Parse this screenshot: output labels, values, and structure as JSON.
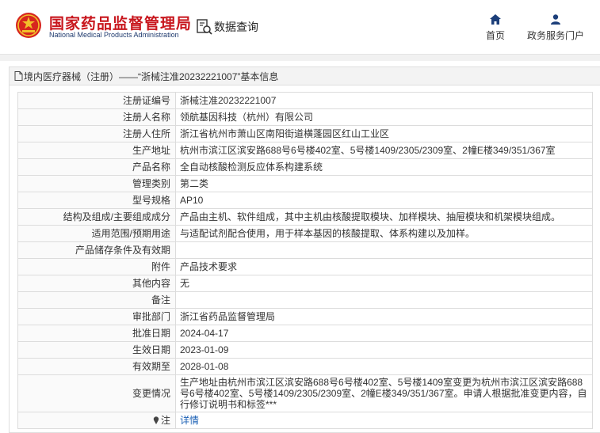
{
  "header": {
    "logo_cn": "国家药品监督管理局",
    "logo_en": "National Medical Products Administration",
    "query_label": "数据查询",
    "nav": [
      {
        "label": "首页",
        "icon": "home-icon"
      },
      {
        "label": "政务服务门户",
        "icon": "user-icon"
      }
    ]
  },
  "panel": {
    "title": "境内医疗器械（注册）——“浙械注准20232221007”基本信息"
  },
  "rows": [
    {
      "label": "注册证编号",
      "value": "浙械注准20232221007"
    },
    {
      "label": "注册人名称",
      "value": "领航基因科技（杭州）有限公司"
    },
    {
      "label": "注册人住所",
      "value": "浙江省杭州市萧山区南阳街道横蓬园区红山工业区"
    },
    {
      "label": "生产地址",
      "value": "杭州市滨江区滨安路688号6号楼402室、5号楼1409/2305/2309室、2幢E楼349/351/367室"
    },
    {
      "label": "产品名称",
      "value": "全自动核酸检测反应体系构建系统"
    },
    {
      "label": "管理类别",
      "value": "第二类"
    },
    {
      "label": "型号规格",
      "value": "AP10"
    },
    {
      "label": "结构及组成/主要组成成分",
      "value": "产品由主机、软件组成，其中主机由核酸提取模块、加样模块、抽屉模块和机架模块组成。"
    },
    {
      "label": "适用范围/预期用途",
      "value": "与适配试剂配合使用，用于样本基因的核酸提取、体系构建以及加样。"
    },
    {
      "label": "产品储存条件及有效期",
      "value": ""
    },
    {
      "label": "附件",
      "value": "产品技术要求"
    },
    {
      "label": "其他内容",
      "value": "无"
    },
    {
      "label": "备注",
      "value": ""
    },
    {
      "label": "审批部门",
      "value": "浙江省药品监督管理局"
    },
    {
      "label": "批准日期",
      "value": "2024-04-17"
    },
    {
      "label": "生效日期",
      "value": "2023-01-09"
    },
    {
      "label": "有效期至",
      "value": "2028-01-08"
    },
    {
      "label": "变更情况",
      "value": "生产地址由杭州市滨江区滨安路688号6号楼402室、5号楼1409室变更为杭州市滨江区滨安路688号6号楼402室、5号楼1409/2305/2309室、2幢E楼349/351/367室。申请人根据批准变更内容，自行修订说明书和标签***"
    }
  ],
  "note_row": {
    "label": "注",
    "value": "详情",
    "icon": "note-icon"
  },
  "colors": {
    "brand_red": "#c8161d",
    "brand_blue": "#1f3a6e",
    "link": "#1a5fb4"
  }
}
